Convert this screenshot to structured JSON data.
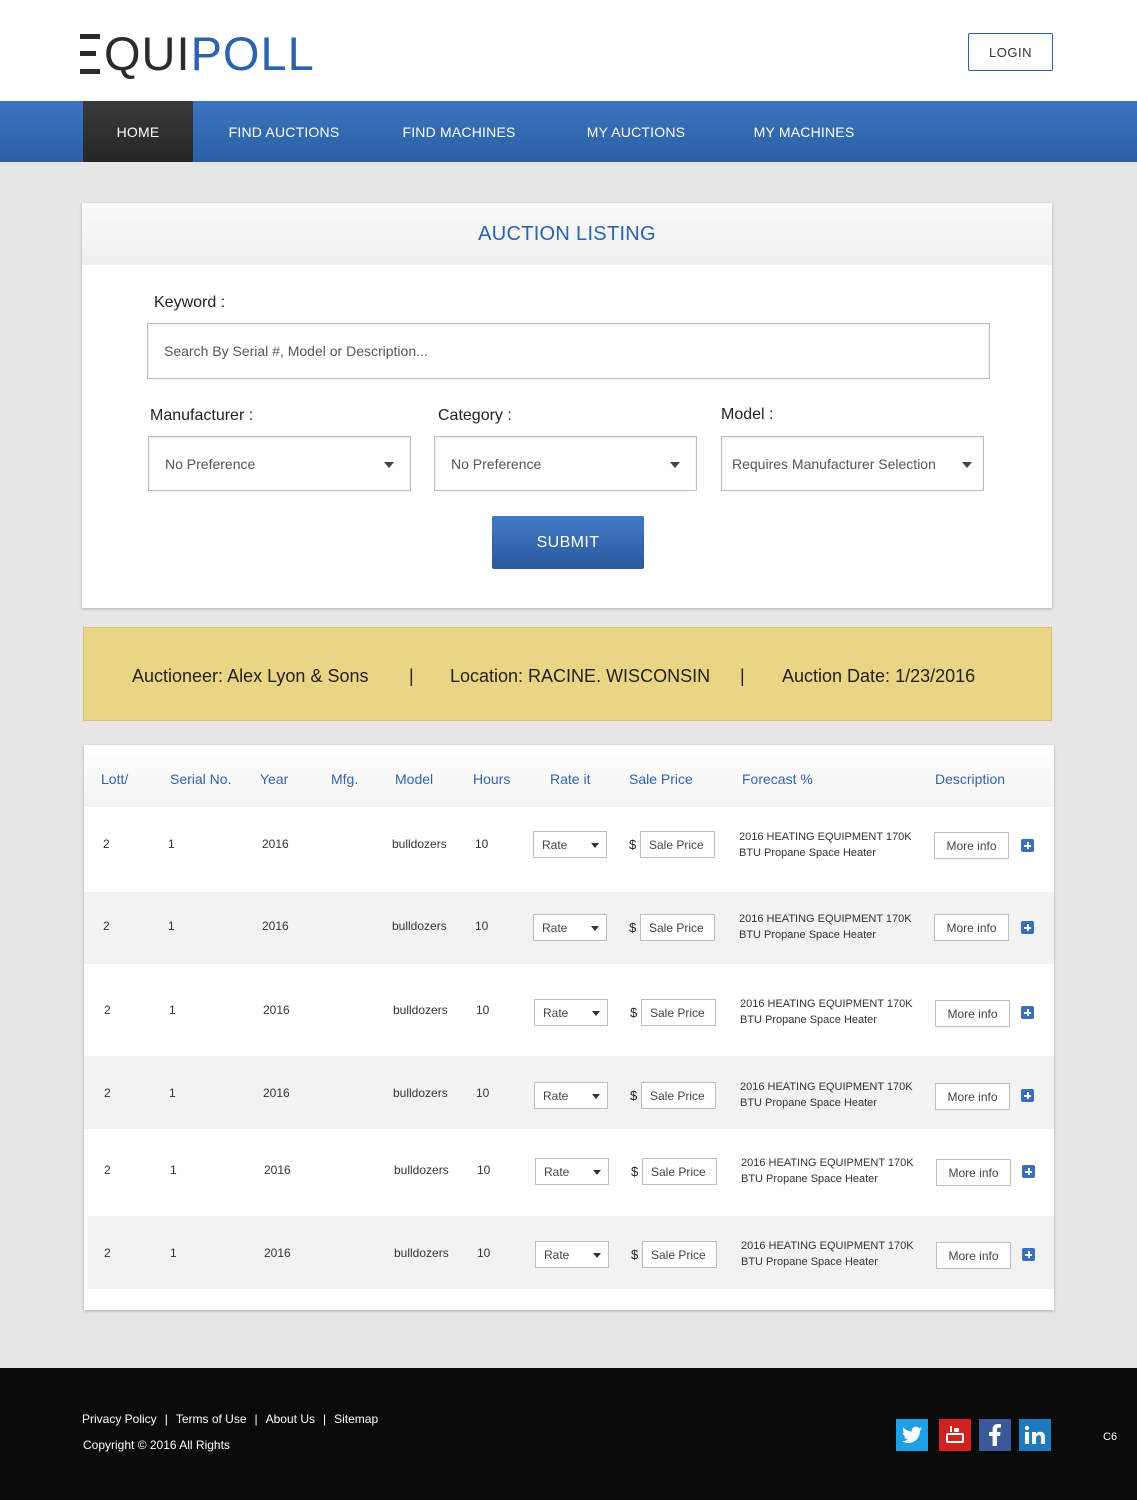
{
  "header": {
    "logo_equi": "QUI",
    "logo_poll": "POLL",
    "login_label": "LOGIN"
  },
  "nav": {
    "items": [
      {
        "label": "HOME"
      },
      {
        "label": "FIND AUCTIONS"
      },
      {
        "label": "FIND MACHINES"
      },
      {
        "label": "MY AUCTIONS"
      },
      {
        "label": "MY MACHINES"
      }
    ]
  },
  "search": {
    "title": "AUCTION LISTING",
    "keyword_label": "Keyword :",
    "keyword_placeholder": "Search By Serial #, Model or Description...",
    "manufacturer_label": "Manufacturer :",
    "manufacturer_value": "No Preference",
    "category_label": "Category :",
    "category_value": "No Preference",
    "model_label": "Model :",
    "model_value": "Requires Manufacturer Selection",
    "submit_label": "SUBMIT"
  },
  "auction_info": {
    "auctioneer": "Auctioneer: Alex Lyon & Sons",
    "sep1": "|",
    "location": "Location: RACINE. WISCONSIN",
    "sep2": "|",
    "date": "Auction Date: 1/23/2016"
  },
  "table": {
    "headers": {
      "lot": "Lott/",
      "serial": "Serial No.",
      "year": "Year",
      "mfg": "Mfg.",
      "model": "Model",
      "hours": "Hours",
      "rate": "Rate it",
      "sale_price": "Sale Price",
      "forecast": "Forecast %",
      "description": "Description"
    },
    "rows": [
      {
        "lot": "2",
        "serial": "1",
        "year": "2016",
        "model": "bulldozers",
        "hours": "10",
        "rate": "Rate",
        "currency": "$",
        "sale_price": "Sale Price",
        "desc1": "2016 HEATING EQUIPMENT 170K",
        "desc2": "BTU Propane Space Heater",
        "more": "More info"
      },
      {
        "lot": "2",
        "serial": "1",
        "year": "2016",
        "model": "bulldozers",
        "hours": "10",
        "rate": "Rate",
        "currency": "$",
        "sale_price": "Sale Price",
        "desc1": "2016 HEATING EQUIPMENT 170K",
        "desc2": "BTU Propane Space Heater",
        "more": "More info"
      },
      {
        "lot": "2",
        "serial": "1",
        "year": "2016",
        "model": "bulldozers",
        "hours": "10",
        "rate": "Rate",
        "currency": "$",
        "sale_price": "Sale Price",
        "desc1": "2016 HEATING EQUIPMENT 170K",
        "desc2": "BTU Propane Space Heater",
        "more": "More info"
      },
      {
        "lot": "2",
        "serial": "1",
        "year": "2016",
        "model": "bulldozers",
        "hours": "10",
        "rate": "Rate",
        "currency": "$",
        "sale_price": "Sale Price",
        "desc1": "2016 HEATING EQUIPMENT 170K",
        "desc2": "BTU Propane Space Heater",
        "more": "More info"
      },
      {
        "lot": "2",
        "serial": "1",
        "year": "2016",
        "model": "bulldozers",
        "hours": "10",
        "rate": "Rate",
        "currency": "$",
        "sale_price": "Sale Price",
        "desc1": "2016 HEATING EQUIPMENT 170K",
        "desc2": "BTU Propane Space Heater",
        "more": "More info"
      },
      {
        "lot": "2",
        "serial": "1",
        "year": "2016",
        "model": "bulldozers",
        "hours": "10",
        "rate": "Rate",
        "currency": "$",
        "sale_price": "Sale Price",
        "desc1": "2016 HEATING EQUIPMENT 170K",
        "desc2": "BTU Propane Space Heater",
        "more": "More info"
      }
    ]
  },
  "footer": {
    "links": [
      {
        "label": "Privacy Policy"
      },
      {
        "label": "Terms of Use"
      },
      {
        "label": "About Us"
      },
      {
        "label": "Sitemap"
      }
    ],
    "separator": "|",
    "copyright": "Copyright © 2016  All Rights",
    "social": [
      {
        "icon": "twitter-icon",
        "glyph": "t",
        "color": "#1da1e2"
      },
      {
        "icon": "youtube-icon",
        "glyph": "You",
        "color": "#d02020"
      },
      {
        "icon": "facebook-icon",
        "glyph": "f",
        "color": "#3b5998"
      },
      {
        "icon": "linkedin-icon",
        "glyph": "in",
        "color": "#1c7bbf"
      }
    ],
    "page_code": "C6"
  },
  "colors": {
    "brand_blue": "#2c63ae",
    "nav_active": "#2b2b2b",
    "info_bar": "#ead584"
  }
}
